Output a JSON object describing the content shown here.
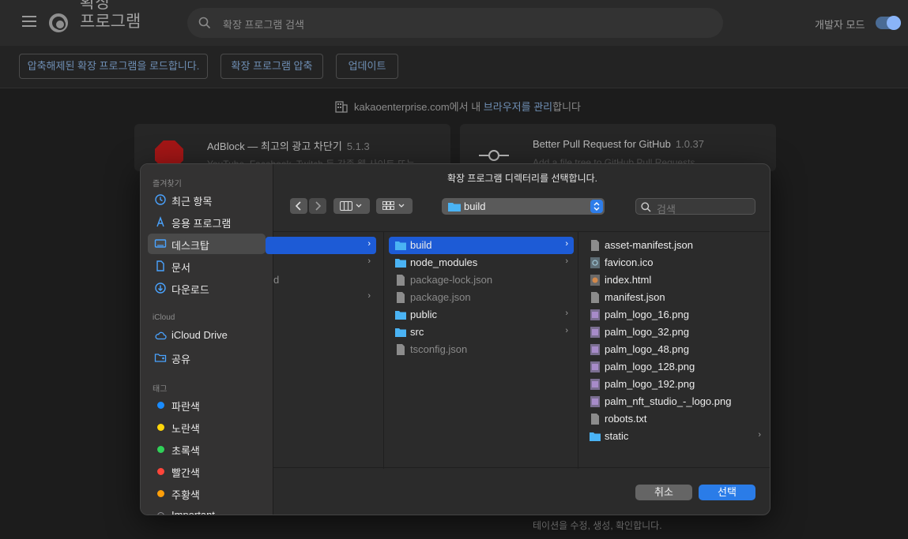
{
  "app": {
    "title": "확장 프로그램",
    "search_placeholder": "확장 프로그램 검색",
    "dev_mode_label": "개발자 모드",
    "dev_mode_on": true
  },
  "toolbar": {
    "load_unpacked": "압축해제된 확장 프로그램을 로드합니다.",
    "pack": "확장 프로그램 압축",
    "update": "업데이트"
  },
  "managed": {
    "prefix": "kakaoenterprise.com에서 내 ",
    "link": "브라우저를 관리",
    "suffix": "합니다"
  },
  "extensions": [
    {
      "name": "AdBlock — 최고의 광고 차단기",
      "version": "5.1.3",
      "desc": "YouTube, Facebook, Twitch 등 각종 웹 사이트 또는"
    },
    {
      "name": "Better Pull Request for GitHub",
      "version": "1.0.37",
      "desc": "Add a file tree to GitHub Pull Requests"
    }
  ],
  "bottom_desc": "테이션을 수정, 생성, 확인합니다.",
  "dialog": {
    "title": "확장 프로그램 디렉터리를 선택합니다.",
    "path": "build",
    "search_placeholder": "검색",
    "cancel": "취소",
    "select": "선택",
    "sidebar": {
      "favorites_header": "즐겨찾기",
      "favorites": [
        {
          "label": "최근 항목",
          "icon": "clock-icon"
        },
        {
          "label": "응용 프로그램",
          "icon": "apps-icon"
        },
        {
          "label": "데스크탑",
          "icon": "desktop-icon",
          "selected": true
        },
        {
          "label": "문서",
          "icon": "document-icon"
        },
        {
          "label": "다운로드",
          "icon": "download-icon"
        }
      ],
      "icloud_header": "iCloud",
      "icloud": [
        {
          "label": "iCloud Drive",
          "icon": "cloud-icon"
        },
        {
          "label": "공유",
          "icon": "shared-folder-icon"
        }
      ],
      "tags_header": "태그",
      "tags": [
        {
          "label": "파란색",
          "color": "#1a8cff"
        },
        {
          "label": "노란색",
          "color": "#ffd60a"
        },
        {
          "label": "초록색",
          "color": "#30d158"
        },
        {
          "label": "빨간색",
          "color": "#ff453a"
        },
        {
          "label": "주황색",
          "color": "#ff9f0a"
        },
        {
          "label": "Important",
          "color": "#8e8e93"
        }
      ]
    },
    "col0_fragment": "d",
    "col1": [
      {
        "label": "build",
        "type": "folder",
        "selected": true,
        "has_children": true
      },
      {
        "label": "node_modules",
        "type": "folder",
        "has_children": true
      },
      {
        "label": "package-lock.json",
        "type": "file",
        "dim": true
      },
      {
        "label": "package.json",
        "type": "file",
        "dim": true
      },
      {
        "label": "public",
        "type": "folder",
        "has_children": true
      },
      {
        "label": "src",
        "type": "folder",
        "has_children": true
      },
      {
        "label": "tsconfig.json",
        "type": "file",
        "dim": true
      }
    ],
    "col2": [
      {
        "label": "asset-manifest.json",
        "type": "file"
      },
      {
        "label": "favicon.ico",
        "type": "ico"
      },
      {
        "label": "index.html",
        "type": "html"
      },
      {
        "label": "manifest.json",
        "type": "file"
      },
      {
        "label": "palm_logo_16.png",
        "type": "image"
      },
      {
        "label": "palm_logo_32.png",
        "type": "image"
      },
      {
        "label": "palm_logo_48.png",
        "type": "image"
      },
      {
        "label": "palm_logo_128.png",
        "type": "image"
      },
      {
        "label": "palm_logo_192.png",
        "type": "image"
      },
      {
        "label": "palm_nft_studio_-_logo.png",
        "type": "image"
      },
      {
        "label": "robots.txt",
        "type": "file"
      },
      {
        "label": "static",
        "type": "folder",
        "has_children": true
      }
    ]
  }
}
